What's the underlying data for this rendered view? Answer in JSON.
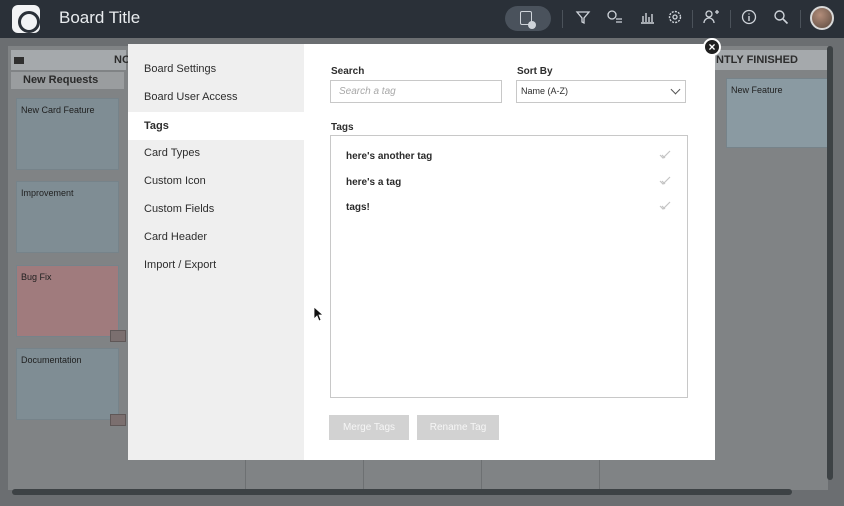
{
  "header": {
    "board_title": "Board Title",
    "icons": [
      "view-toggle-icon",
      "filter-icon",
      "tag-filter-icon",
      "chart-icon",
      "gear-icon",
      "add-user-icon",
      "info-icon",
      "search-icon"
    ]
  },
  "board": {
    "lane_left_header": "NO",
    "lane_right_header": "NTLY FINISHED",
    "sub_lane": "New Requests",
    "cards": [
      {
        "title": "New Card Feature"
      },
      {
        "title": "Improvement"
      },
      {
        "title": "Bug Fix"
      },
      {
        "title": "Documentation"
      }
    ],
    "right_card": "New Feature"
  },
  "modal": {
    "nav": [
      {
        "label": "Board Settings",
        "active": false
      },
      {
        "label": "Board User Access",
        "active": false
      },
      {
        "label": "Tags",
        "active": true
      },
      {
        "label": "Card Types",
        "active": false
      },
      {
        "label": "Custom Icon",
        "active": false
      },
      {
        "label": "Custom Fields",
        "active": false
      },
      {
        "label": "Card Header",
        "active": false
      },
      {
        "label": "Import / Export",
        "active": false
      }
    ],
    "search_label": "Search",
    "search_placeholder": "Search a tag",
    "sort_label": "Sort By",
    "sort_value": "Name (A-Z)",
    "tags_label": "Tags",
    "tags": [
      "here's another tag",
      "here's a tag",
      "tags!"
    ],
    "merge_button": "Merge Tags",
    "rename_button": "Rename Tag",
    "close_icon": "close-icon"
  },
  "colors": {
    "header_bg": "#2a3038",
    "disabled_button": "#d2d2d2",
    "side_bg": "#efefef"
  }
}
